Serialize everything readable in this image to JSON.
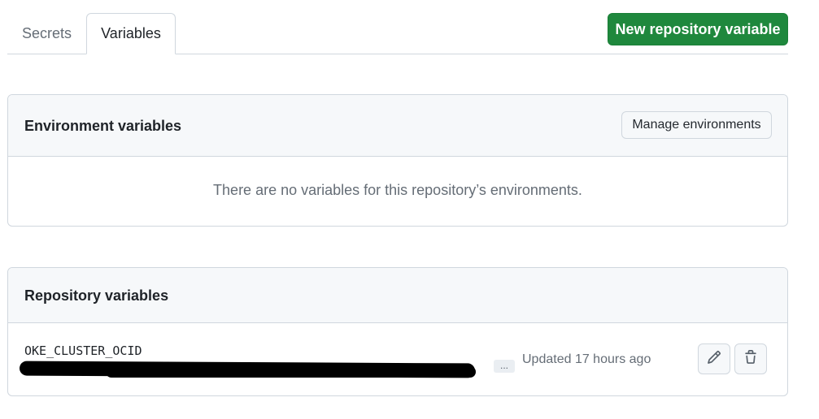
{
  "tabs": [
    {
      "label": "Secrets",
      "selected": false
    },
    {
      "label": "Variables",
      "selected": true
    }
  ],
  "toolbar": {
    "new_variable_label": "New repository variable"
  },
  "environment_variables": {
    "title": "Environment variables",
    "manage_label": "Manage environments",
    "empty_message": "There are no variables for this repository’s environments."
  },
  "repository_variables": {
    "title": "Repository variables",
    "items": [
      {
        "name": "OKE_CLUSTER_OCID",
        "value_redacted": true,
        "more_label": "...",
        "updated": "Updated 17 hours ago",
        "edit_icon": "pencil-icon",
        "delete_icon": "trash-icon"
      }
    ]
  },
  "colors": {
    "primary": "#1f883d",
    "border": "#d0d7de",
    "header_bg": "#f6f8fa",
    "muted_text": "#656d76"
  }
}
